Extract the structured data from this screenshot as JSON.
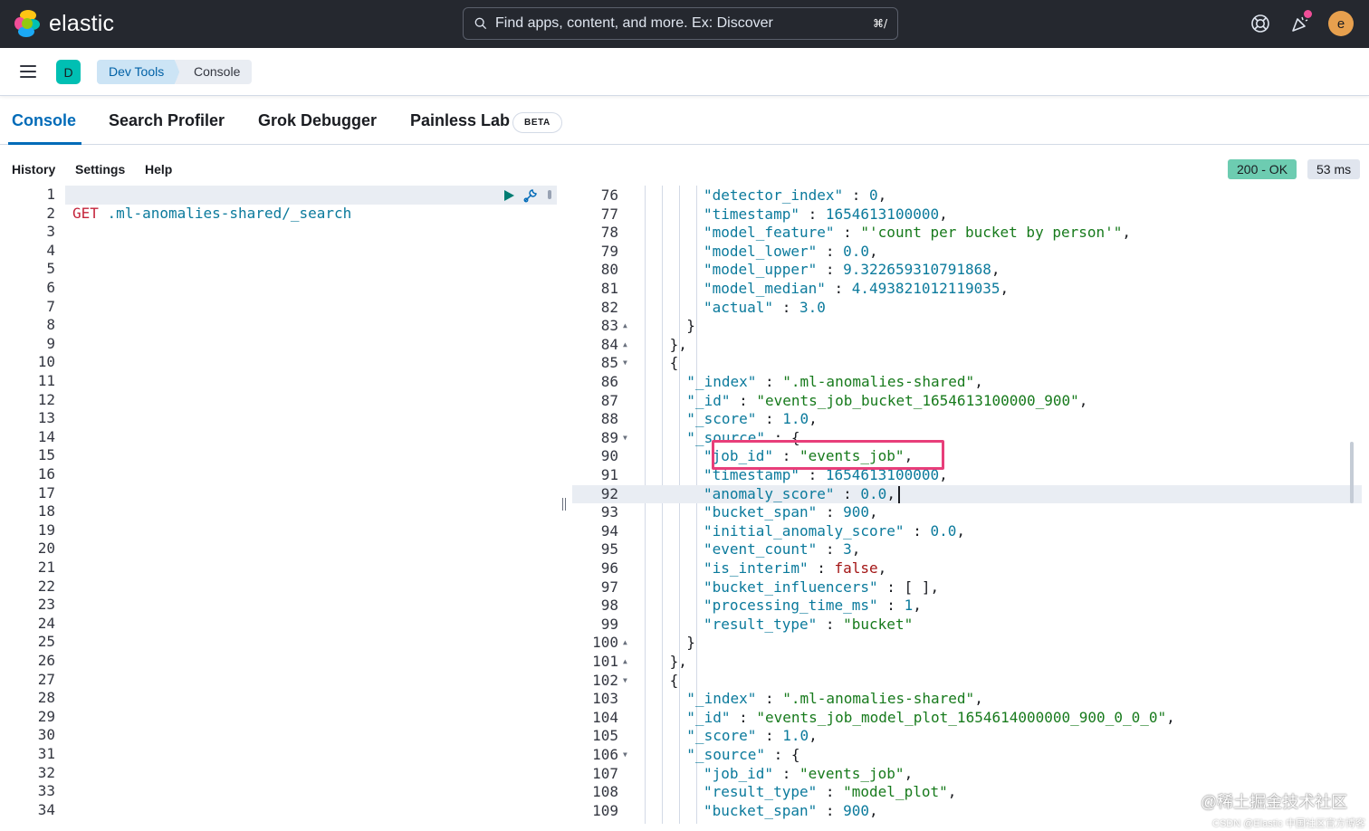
{
  "header": {
    "brand": "elastic",
    "search_placeholder": "Find apps, content, and more. Ex: Discover",
    "search_shortcut": "⌘/",
    "avatar_initial": "e",
    "icons": [
      "help-icon",
      "news-feed-icon"
    ]
  },
  "breadcrumbs": {
    "space_initial": "D",
    "items": [
      "Dev Tools",
      "Console"
    ]
  },
  "tabs": [
    {
      "label": "Console",
      "active": true
    },
    {
      "label": "Search Profiler",
      "active": false
    },
    {
      "label": "Grok Debugger",
      "active": false
    },
    {
      "label": "Painless Lab",
      "active": false,
      "badge": "BETA"
    }
  ],
  "console_menu": [
    "History",
    "Settings",
    "Help"
  ],
  "response_status": {
    "status": "200 - OK",
    "time": "53 ms"
  },
  "request": {
    "line_count": 34,
    "method": "GET",
    "path": ".ml-anomalies-shared/_search"
  },
  "response": {
    "lines": [
      {
        "n": "76",
        "fold": "",
        "depth": 4,
        "tokens": [
          [
            "k",
            "\"detector_index\""
          ],
          [
            "p",
            " : "
          ],
          [
            "n",
            "0"
          ],
          [
            "p",
            ","
          ]
        ]
      },
      {
        "n": "77",
        "fold": "",
        "depth": 4,
        "tokens": [
          [
            "k",
            "\"timestamp\""
          ],
          [
            "p",
            " : "
          ],
          [
            "n",
            "1654613100000"
          ],
          [
            "p",
            ","
          ]
        ]
      },
      {
        "n": "78",
        "fold": "",
        "depth": 4,
        "tokens": [
          [
            "k",
            "\"model_feature\""
          ],
          [
            "p",
            " : "
          ],
          [
            "s",
            "\"'count per bucket by person'\""
          ],
          [
            "p",
            ","
          ]
        ]
      },
      {
        "n": "79",
        "fold": "",
        "depth": 4,
        "tokens": [
          [
            "k",
            "\"model_lower\""
          ],
          [
            "p",
            " : "
          ],
          [
            "n",
            "0.0"
          ],
          [
            "p",
            ","
          ]
        ]
      },
      {
        "n": "80",
        "fold": "",
        "depth": 4,
        "tokens": [
          [
            "k",
            "\"model_upper\""
          ],
          [
            "p",
            " : "
          ],
          [
            "n",
            "9.322659310791868"
          ],
          [
            "p",
            ","
          ]
        ]
      },
      {
        "n": "81",
        "fold": "",
        "depth": 4,
        "tokens": [
          [
            "k",
            "\"model_median\""
          ],
          [
            "p",
            " : "
          ],
          [
            "n",
            "4.493821012119035"
          ],
          [
            "p",
            ","
          ]
        ]
      },
      {
        "n": "82",
        "fold": "",
        "depth": 4,
        "tokens": [
          [
            "k",
            "\"actual\""
          ],
          [
            "p",
            " : "
          ],
          [
            "n",
            "3.0"
          ]
        ]
      },
      {
        "n": "83",
        "fold": "▲",
        "depth": 3,
        "tokens": [
          [
            "p",
            "}"
          ]
        ]
      },
      {
        "n": "84",
        "fold": "▲",
        "depth": 2,
        "tokens": [
          [
            "p",
            "},"
          ]
        ]
      },
      {
        "n": "85",
        "fold": "▼",
        "depth": 2,
        "tokens": [
          [
            "p",
            "{"
          ]
        ]
      },
      {
        "n": "86",
        "fold": "",
        "depth": 3,
        "tokens": [
          [
            "k",
            "\"_index\""
          ],
          [
            "p",
            " : "
          ],
          [
            "s",
            "\".ml-anomalies-shared\""
          ],
          [
            "p",
            ","
          ]
        ]
      },
      {
        "n": "87",
        "fold": "",
        "depth": 3,
        "tokens": [
          [
            "k",
            "\"_id\""
          ],
          [
            "p",
            " : "
          ],
          [
            "s",
            "\"events_job_bucket_1654613100000_900\""
          ],
          [
            "p",
            ","
          ]
        ]
      },
      {
        "n": "88",
        "fold": "",
        "depth": 3,
        "tokens": [
          [
            "k",
            "\"_score\""
          ],
          [
            "p",
            " : "
          ],
          [
            "n",
            "1.0"
          ],
          [
            "p",
            ","
          ]
        ]
      },
      {
        "n": "89",
        "fold": "▼",
        "depth": 3,
        "tokens": [
          [
            "k",
            "\"_source\""
          ],
          [
            "p",
            " : {"
          ]
        ]
      },
      {
        "n": "90",
        "fold": "",
        "depth": 4,
        "tokens": [
          [
            "k",
            "\"job_id\""
          ],
          [
            "p",
            " : "
          ],
          [
            "s",
            "\"events_job\""
          ],
          [
            "p",
            ","
          ]
        ]
      },
      {
        "n": "91",
        "fold": "",
        "depth": 4,
        "tokens": [
          [
            "k",
            "\"timestamp\""
          ],
          [
            "p",
            " : "
          ],
          [
            "n",
            "1654613100000"
          ],
          [
            "p",
            ","
          ]
        ]
      },
      {
        "n": "92",
        "fold": "",
        "depth": 4,
        "tokens": [
          [
            "k",
            "\"anomaly_score\""
          ],
          [
            "p",
            " : "
          ],
          [
            "n",
            "0.0"
          ],
          [
            "p",
            ","
          ]
        ]
      },
      {
        "n": "93",
        "fold": "",
        "depth": 4,
        "tokens": [
          [
            "k",
            "\"bucket_span\""
          ],
          [
            "p",
            " : "
          ],
          [
            "n",
            "900"
          ],
          [
            "p",
            ","
          ]
        ]
      },
      {
        "n": "94",
        "fold": "",
        "depth": 4,
        "tokens": [
          [
            "k",
            "\"initial_anomaly_score\""
          ],
          [
            "p",
            " : "
          ],
          [
            "n",
            "0.0"
          ],
          [
            "p",
            ","
          ]
        ]
      },
      {
        "n": "95",
        "fold": "",
        "depth": 4,
        "tokens": [
          [
            "k",
            "\"event_count\""
          ],
          [
            "p",
            " : "
          ],
          [
            "n",
            "3"
          ],
          [
            "p",
            ","
          ]
        ]
      },
      {
        "n": "96",
        "fold": "",
        "depth": 4,
        "tokens": [
          [
            "k",
            "\"is_interim\""
          ],
          [
            "p",
            " : "
          ],
          [
            "b",
            "false"
          ],
          [
            "p",
            ","
          ]
        ]
      },
      {
        "n": "97",
        "fold": "",
        "depth": 4,
        "tokens": [
          [
            "k",
            "\"bucket_influencers\""
          ],
          [
            "p",
            " : [ ],"
          ]
        ]
      },
      {
        "n": "98",
        "fold": "",
        "depth": 4,
        "tokens": [
          [
            "k",
            "\"processing_time_ms\""
          ],
          [
            "p",
            " : "
          ],
          [
            "n",
            "1"
          ],
          [
            "p",
            ","
          ]
        ]
      },
      {
        "n": "99",
        "fold": "",
        "depth": 4,
        "tokens": [
          [
            "k",
            "\"result_type\""
          ],
          [
            "p",
            " : "
          ],
          [
            "s",
            "\"bucket\""
          ]
        ]
      },
      {
        "n": "100",
        "fold": "▲",
        "depth": 3,
        "tokens": [
          [
            "p",
            "}"
          ]
        ]
      },
      {
        "n": "101",
        "fold": "▲",
        "depth": 2,
        "tokens": [
          [
            "p",
            "},"
          ]
        ]
      },
      {
        "n": "102",
        "fold": "▼",
        "depth": 2,
        "tokens": [
          [
            "p",
            "{"
          ]
        ]
      },
      {
        "n": "103",
        "fold": "",
        "depth": 3,
        "tokens": [
          [
            "k",
            "\"_index\""
          ],
          [
            "p",
            " : "
          ],
          [
            "s",
            "\".ml-anomalies-shared\""
          ],
          [
            "p",
            ","
          ]
        ]
      },
      {
        "n": "104",
        "fold": "",
        "depth": 3,
        "tokens": [
          [
            "k",
            "\"_id\""
          ],
          [
            "p",
            " : "
          ],
          [
            "s",
            "\"events_job_model_plot_1654614000000_900_0_0_0\""
          ],
          [
            "p",
            ","
          ]
        ]
      },
      {
        "n": "105",
        "fold": "",
        "depth": 3,
        "tokens": [
          [
            "k",
            "\"_score\""
          ],
          [
            "p",
            " : "
          ],
          [
            "n",
            "1.0"
          ],
          [
            "p",
            ","
          ]
        ]
      },
      {
        "n": "106",
        "fold": "▼",
        "depth": 3,
        "tokens": [
          [
            "k",
            "\"_source\""
          ],
          [
            "p",
            " : {"
          ]
        ]
      },
      {
        "n": "107",
        "fold": "",
        "depth": 4,
        "tokens": [
          [
            "k",
            "\"job_id\""
          ],
          [
            "p",
            " : "
          ],
          [
            "s",
            "\"events_job\""
          ],
          [
            "p",
            ","
          ]
        ]
      },
      {
        "n": "108",
        "fold": "",
        "depth": 4,
        "tokens": [
          [
            "k",
            "\"result_type\""
          ],
          [
            "p",
            " : "
          ],
          [
            "s",
            "\"model_plot\""
          ],
          [
            "p",
            ","
          ]
        ]
      },
      {
        "n": "109",
        "fold": "",
        "depth": 4,
        "tokens": [
          [
            "k",
            "\"bucket_span\""
          ],
          [
            "p",
            " : "
          ],
          [
            "n",
            "900"
          ],
          [
            "p",
            ","
          ]
        ]
      }
    ],
    "active_line": "92",
    "highlighted_line": "90"
  },
  "watermark": {
    "main": "@稀土掘金技术社区",
    "sub": "CSDN @Elastic 中国社区官方博客"
  }
}
